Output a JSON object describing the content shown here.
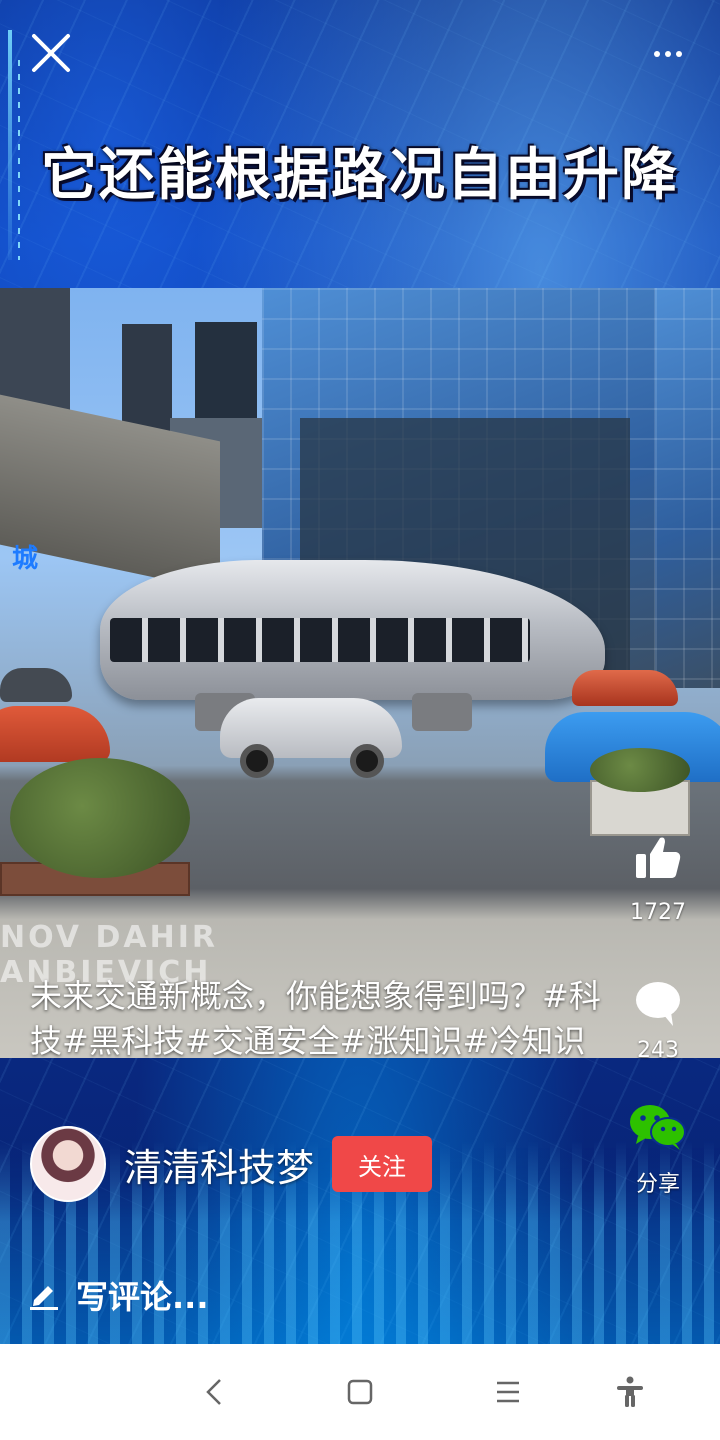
{
  "video": {
    "caption": "它还能根据路况自由升降",
    "watermark_lines": [
      "NOV  DAHIR",
      "ANBIEVICH"
    ]
  },
  "top_bar": {
    "close_icon": "close-icon",
    "more_icon": "more-icon"
  },
  "actions": {
    "like": {
      "icon": "thumbs-up-icon",
      "count": "1727"
    },
    "comment": {
      "icon": "comment-bubble-icon",
      "count": "243"
    },
    "share": {
      "icon": "wechat-icon",
      "label": "分享",
      "color": "#2dc100"
    }
  },
  "post": {
    "description": "未来交通新概念，你能想象得到吗？#科技#黑科技#交通安全#涨知识#冷知识"
  },
  "author": {
    "name": "清清科技梦",
    "follow_label": "关注",
    "follow_color": "#f04848"
  },
  "comment_input": {
    "placeholder": "写评论..."
  },
  "system_nav": {
    "back_icon": "back-icon",
    "home_icon": "home-icon",
    "menu_icon": "menu-icon",
    "accessibility_icon": "accessibility-icon"
  }
}
